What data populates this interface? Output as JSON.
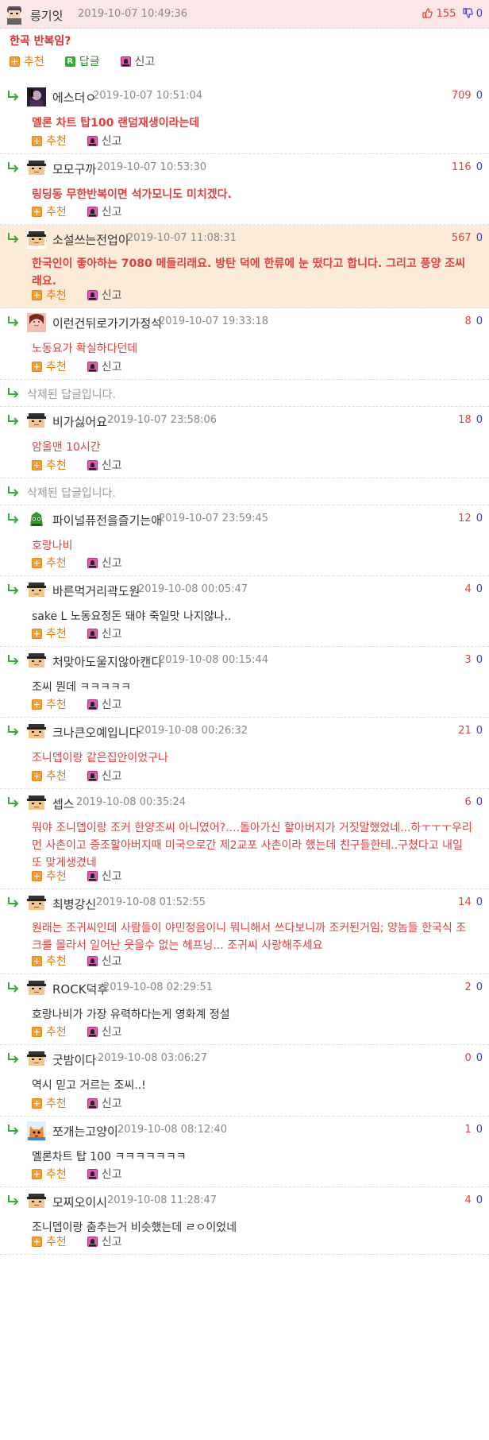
{
  "labels": {
    "recommend": "추천",
    "reply": "답글",
    "report": "신고"
  },
  "post": {
    "author": "릉기잇",
    "date": "2019-10-07 10:49:36",
    "up": "155",
    "down": "0",
    "body": "한곡 반복임?"
  },
  "comments": [
    {
      "kind": "reply",
      "nick": "에스더ㅇ",
      "date": "2019-10-07 10:51:04",
      "up": "709",
      "down": "0",
      "body": "멜론 차트 탑100 랜덤재생이라는데",
      "style": "redbold",
      "avatar": "photo-dark",
      "h": 90,
      "dateX": 117
    },
    {
      "kind": "reply",
      "nick": "모모구까",
      "date": "2019-10-07 10:53:30",
      "up": "116",
      "down": "0",
      "body": "링딩동 무한반복이면 석가모니도 미치겠다.",
      "style": "redbold",
      "avatar": "pixel",
      "h": 89,
      "dateX": 122
    },
    {
      "kind": "reply",
      "nick": "소설쓰는전업이",
      "date": "2019-10-07 11:08:31",
      "up": "567",
      "down": "0",
      "body": "한국인이 좋아하는 7080 메들리래요. 방탄 덕에 한류에 눈 떴다고 합니다. 그리고 풍양 조씨래요.",
      "style": "redbold",
      "avatar": "pixel",
      "h": 105,
      "dateX": 160,
      "hl": true
    },
    {
      "kind": "reply",
      "nick": "이런건뒤로가기가정석",
      "date": "2019-10-07 19:33:18",
      "up": "8",
      "down": "0",
      "body": "노동요가 확실하다던데",
      "style": "red",
      "avatar": "photo-face",
      "h": 90,
      "dateX": 200
    },
    {
      "kind": "deleted",
      "text": "삭제된 답글입니다.",
      "h": 34
    },
    {
      "kind": "reply",
      "nick": "비가싫어요",
      "date": "2019-10-07 23:58:06",
      "up": "18",
      "down": "0",
      "body": "암울맨 10시간",
      "style": "red",
      "avatar": "pixel",
      "h": 90,
      "dateX": 135
    },
    {
      "kind": "deleted",
      "text": "삭제된 답글입니다.",
      "h": 34
    },
    {
      "kind": "reply",
      "nick": "파이널퓨전을즐기는애",
      "date": "2019-10-07 23:59:45",
      "up": "12",
      "down": "0",
      "body": "호랑나비",
      "style": "red",
      "avatar": "green",
      "h": 89,
      "dateX": 200
    },
    {
      "kind": "reply",
      "nick": "바른먹거리곽도원",
      "date": "2019-10-08 00:05:47",
      "up": "4",
      "down": "0",
      "body": "sake L 노동요정돈 돼야 죽일맛 나지않나..",
      "style": "dark",
      "avatar": "pixel",
      "h": 89,
      "dateX": 174
    },
    {
      "kind": "reply",
      "nick": "처맞아도울지않아캔디",
      "date": "2019-10-08 00:15:44",
      "up": "3",
      "down": "0",
      "body": "조씨 뭔데 ㅋㅋㅋㅋㅋ",
      "style": "dark",
      "avatar": "pixel",
      "h": 89,
      "dateX": 200
    },
    {
      "kind": "reply",
      "nick": "크나큰오예입니다",
      "date": "2019-10-08 00:26:32",
      "up": "21",
      "down": "0",
      "body": "조니뎁이랑 같은집안이었구나",
      "style": "red",
      "avatar": "pixel",
      "h": 90,
      "dateX": 174
    },
    {
      "kind": "reply",
      "nick": "셉스",
      "date": "2019-10-08 00:35:24",
      "up": "6",
      "down": "0",
      "body": "뭐야 조니뎁이랑 조커 한양조씨 아니였어?....돌아가신 할아버지가 거짓말했었네...하ㅜㅜㅜ우리 먼 사촌이고 증조할아버지때 미국으로간 제2교포 사촌이라 했는데 친구들한테..구쳤다고 내일 또 맞게생겼네",
      "style": "red",
      "avatar": "pixel",
      "h": 126,
      "dateX": 96
    },
    {
      "kind": "reply",
      "nick": "최병강신",
      "date": "2019-10-08 01:52:55",
      "up": "14",
      "down": "0",
      "body": "원래는 조귀씨인데 사람들이 야민정음이니 뭐니해서 쓰다보니까 조커된거임; 양놈들 한국식 조크를 몰라서 일어난 웃을수 없는 헤프닝... 조귀씨 사랑해주세요",
      "style": "red",
      "avatar": "pixel",
      "h": 107,
      "dateX": 121
    },
    {
      "kind": "reply",
      "nick": "ROCK덕후",
      "date": "2019-10-08 02:29:51",
      "up": "2",
      "down": "0",
      "body": "호랑나비가 가장 유력하다는게 영화계 정설",
      "style": "dark",
      "avatar": "pixel",
      "h": 89,
      "dateX": 130
    },
    {
      "kind": "reply",
      "nick": "굿밤이다",
      "date": "2019-10-08 03:06:27",
      "up": "0",
      "down": "0",
      "body": "역시 믿고 거르는 조씨..!",
      "style": "dark",
      "avatar": "pixel",
      "h": 90,
      "dateX": 123
    },
    {
      "kind": "reply",
      "nick": "쪼개는고양이",
      "date": "2019-10-08 08:12:40",
      "up": "1",
      "down": "0",
      "body": "멜론차트 탑 100 ㅋㅋㅋㅋㅋㅋㅋ",
      "style": "dark",
      "avatar": "cat",
      "h": 89,
      "dateX": 148
    },
    {
      "kind": "reply",
      "nick": "모찌오이시",
      "date": "2019-10-08 11:28:47",
      "up": "4",
      "down": "0",
      "body": "조니뎁이랑 춤추는거 비슷했는데 ㄹㅇ이었네",
      "style": "dark",
      "avatar": "pixel",
      "h": 85,
      "dateX": 135
    }
  ]
}
